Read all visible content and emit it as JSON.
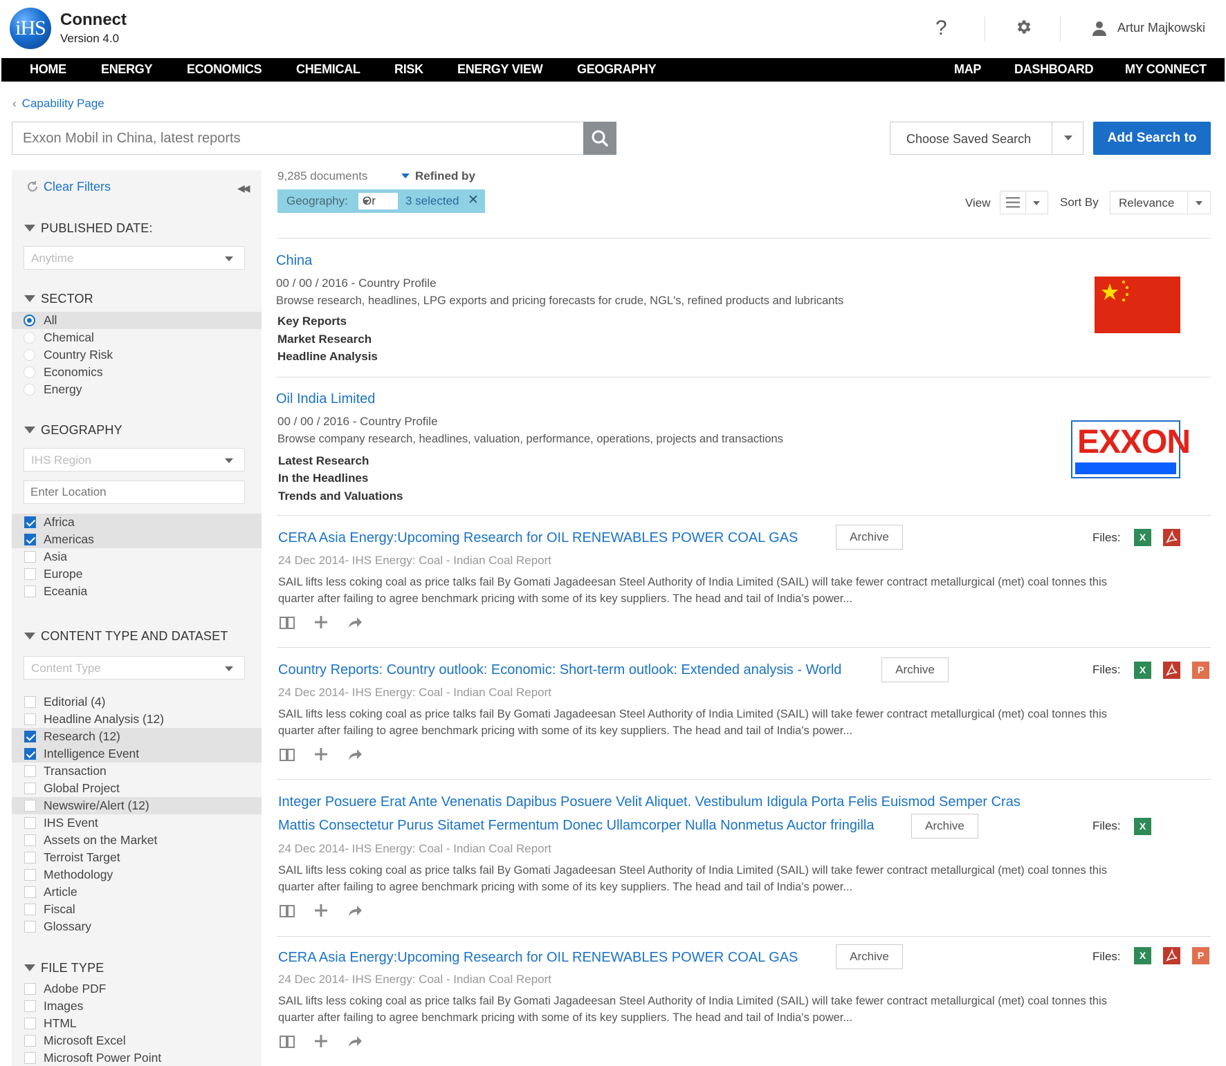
{
  "app": {
    "logo_text": "iHS",
    "name": "Connect",
    "version": "Version 4.0"
  },
  "header": {
    "help_label": "?",
    "user_name": "Artur Majkowski"
  },
  "nav": {
    "left": [
      "HOME",
      "ENERGY",
      "ECONOMICS",
      "CHEMICAL",
      "RISK",
      "ENERGY VIEW",
      "GEOGRAPHY"
    ],
    "right": [
      "MAP",
      "DASHBOARD",
      "MY CONNECT"
    ]
  },
  "breadcrumb": {
    "label": "Capability Page"
  },
  "search": {
    "placeholder": "Exxon Mobil in China, latest reports",
    "saved_search_label": "Choose Saved Search",
    "add_button": "Add Search to"
  },
  "sidebar": {
    "clear_filters": "Clear Filters",
    "published_date": {
      "title": "PUBLISHED DATE:",
      "placeholder": "Anytime"
    },
    "sector": {
      "title": "SECTOR",
      "options": [
        "All",
        "Chemical",
        "Country Risk",
        "Economics",
        "Energy"
      ],
      "selected": "All"
    },
    "geography": {
      "title": "GEOGRAPHY",
      "region_placeholder": "IHS Region",
      "location_placeholder": "Enter Location",
      "options": [
        {
          "label": "Africa",
          "checked": true
        },
        {
          "label": "Americas",
          "checked": true
        },
        {
          "label": "Asia",
          "checked": false
        },
        {
          "label": "Europe",
          "checked": false
        },
        {
          "label": "Eceania",
          "checked": false
        }
      ]
    },
    "content_type": {
      "title": "CONTENT TYPE AND DATASET",
      "placeholder": "Content Type",
      "options": [
        {
          "label": "Editorial  (4)",
          "checked": false,
          "highlight": false
        },
        {
          "label": "Headline Analysis (12)",
          "checked": false,
          "highlight": false
        },
        {
          "label": "Research (12)",
          "checked": true,
          "highlight": true
        },
        {
          "label": "Intelligence Event",
          "checked": true,
          "highlight": true
        },
        {
          "label": "Transaction",
          "checked": false,
          "highlight": false
        },
        {
          "label": "Global Project",
          "checked": false,
          "highlight": false
        },
        {
          "label": "Newswire/Alert (12)",
          "checked": false,
          "highlight": true
        },
        {
          "label": "IHS Event",
          "checked": false,
          "highlight": false
        },
        {
          "label": "Assets on the Market",
          "checked": false,
          "highlight": false
        },
        {
          "label": "Terroist Target",
          "checked": false,
          "highlight": false
        },
        {
          "label": "Methodology",
          "checked": false,
          "highlight": false
        },
        {
          "label": "Article",
          "checked": false,
          "highlight": false
        },
        {
          "label": "Fiscal",
          "checked": false,
          "highlight": false
        },
        {
          "label": "Glossary",
          "checked": false,
          "highlight": false
        }
      ]
    },
    "file_type": {
      "title": "FILE TYPE",
      "options": [
        "Adobe PDF",
        "Images",
        "HTML",
        "Microsoft Excel",
        "Microsoft Power Point"
      ]
    }
  },
  "results_header": {
    "doc_count": "9,285 documents",
    "refined_by": "Refined by",
    "chip": {
      "key": "Geography:",
      "operator": "Or",
      "selection": "3 selected",
      "remove": "✕"
    },
    "view_label": "View",
    "sort_label": "Sort By",
    "sort_value": "Relevance"
  },
  "profiles": [
    {
      "title": "China",
      "meta": "00 / 00 / 2016 - Country Profile",
      "desc": "Browse research, headlines, LPG exports and pricing forecasts for crude, NGL's, refined products and lubricants",
      "links": [
        "Key Reports",
        "Market Research",
        "Headline Analysis"
      ]
    },
    {
      "title": "Oil India Limited",
      "meta": "00 / 00 / 2016 - Country Profile",
      "desc": "Browse company research, headlines, valuation, performance, operations, projects and transactions",
      "links": [
        "Latest Research",
        "In the Headlines",
        "Trends and Valuations"
      ],
      "logo_text": "EXXON"
    }
  ],
  "results": [
    {
      "title": "CERA Asia Energy:Upcoming Research for OIL RENEWABLES POWER COAL GAS",
      "meta": "24 Dec 2014- IHS Energy: Coal - Indian Coal Report",
      "desc1": "SAIL lifts less coking coal as price talks fail By Gomati Jagadeesan Steel Authority of India Limited (SAIL) will take fewer contract metallurgical (met) coal tonnes this",
      "desc2": "quarter after failing to agree benchmark pricing with some of its key suppliers. The head and tail of India's power...",
      "files": [
        "X",
        "PDF"
      ]
    },
    {
      "title": "Country Reports: Country outlook: Economic: Short-term outlook: Extended analysis - World",
      "meta": "24 Dec 2014- IHS Energy: Coal - Indian Coal Report",
      "desc1": "SAIL lifts less coking coal as price talks fail By Gomati Jagadeesan Steel Authority of India Limited (SAIL) will take fewer contract metallurgical (met) coal tonnes this",
      "desc2": "quarter after failing to agree benchmark pricing with some of its key suppliers. The head and tail of India's power...",
      "files": [
        "X",
        "PDF",
        "P"
      ]
    },
    {
      "title": "Integer Posuere Erat Ante Venenatis Dapibus Posuere Velit Aliquet. Vestibulum Idigula Porta Felis Euismod Semper Cras",
      "title2": "Mattis Consectetur Purus Sitamet Fermentum Donec Ullamcorper Nulla Nonmetus Auctor fringilla",
      "meta": "24 Dec 2014- IHS Energy: Coal - Indian Coal Report",
      "desc1": "SAIL lifts less coking coal as price talks fail By Gomati Jagadeesan Steel Authority of India Limited (SAIL) will take fewer contract metallurgical (met) coal tonnes this",
      "desc2": "quarter after failing to agree benchmark pricing with some of its key suppliers. The head and tail of India's power...",
      "files": [
        "X"
      ]
    },
    {
      "title": "CERA Asia Energy:Upcoming Research for OIL RENEWABLES POWER COAL GAS",
      "meta": "24 Dec 2014- IHS Energy: Coal - Indian Coal Report",
      "desc1": "SAIL lifts less coking coal as price talks fail By Gomati Jagadeesan Steel Authority of India Limited (SAIL) will take fewer contract metallurgical (met) coal tonnes this",
      "desc2": "quarter after failing to agree benchmark pricing with some of its key suppliers. The head and tail of India's power...",
      "files": [
        "X",
        "PDF",
        "P"
      ]
    }
  ],
  "labels": {
    "archive": "Archive",
    "files": "Files:"
  },
  "colors": {
    "brand_blue": "#1a6ec8",
    "nav_bg": "#000000",
    "chip_bg": "#8ed0e4",
    "excel": "#2e8b57",
    "pdf": "#c0392b",
    "ppt": "#e0704f"
  }
}
